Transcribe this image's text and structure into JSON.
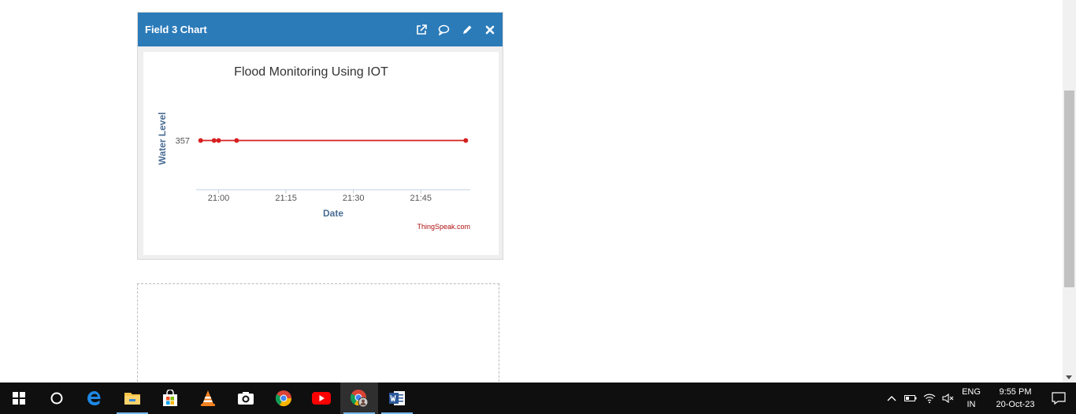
{
  "widget": {
    "title": "Field 3 Chart",
    "header_icons": [
      "external-link-icon",
      "comment-icon",
      "pencil-icon",
      "close-icon"
    ]
  },
  "chart_data": {
    "type": "line",
    "title": "Flood Monitoring Using IOT",
    "xlabel": "Date",
    "ylabel": "Water Level",
    "x_ticks": [
      "21:00",
      "21:15",
      "21:30",
      "21:45"
    ],
    "y_ticks": [
      357
    ],
    "x": [
      "20:56",
      "20:59",
      "21:00",
      "21:04",
      "21:55"
    ],
    "series": [
      {
        "values": [
          357,
          357,
          357,
          357,
          357
        ],
        "color": "#d62020"
      }
    ],
    "xlim": [
      "20:55",
      "21:56"
    ],
    "ylim": [
      350,
      364
    ],
    "grid": false,
    "credit": "ThingSpeak.com"
  },
  "taskbar": {
    "apps": [
      "windows-start-icon",
      "cortana-icon",
      "edge-icon",
      "file-explorer-icon",
      "store-icon",
      "vlc-icon",
      "camera-icon",
      "chrome-icon",
      "youtube-icon",
      "chrome-profile-icon",
      "word-icon"
    ],
    "lang_line1": "ENG",
    "lang_line2": "IN",
    "time": "9:55 PM",
    "date": "20-Oct-23"
  },
  "colors": {
    "header": "#2b7bb9",
    "line": "#d62020",
    "axis_label": "#4a6d94",
    "taskbar": "#0f0f0f"
  }
}
